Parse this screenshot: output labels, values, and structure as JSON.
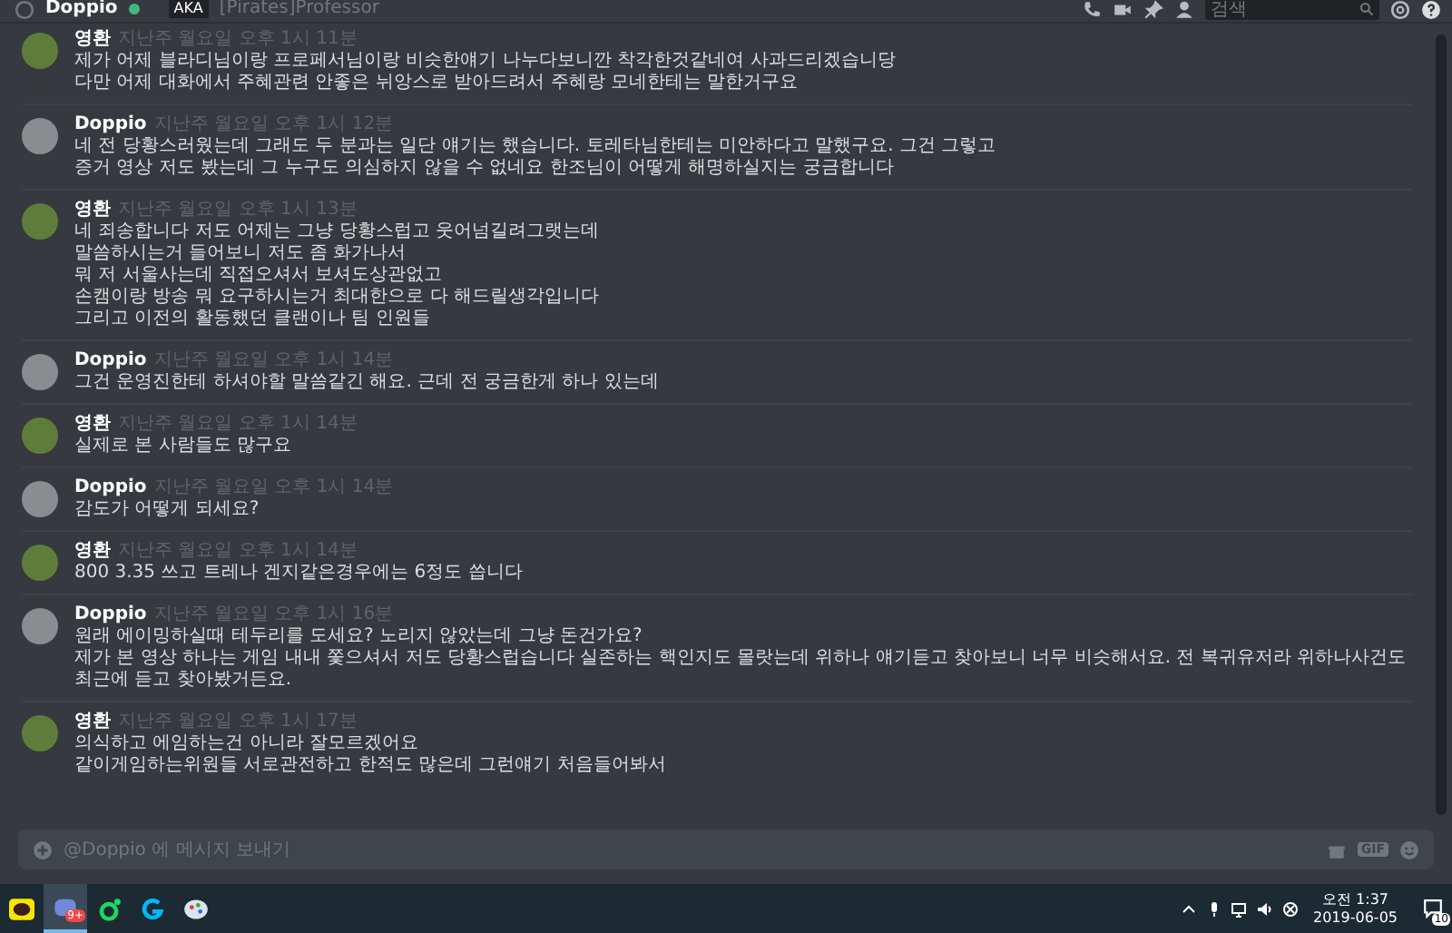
{
  "header": {
    "recipient": "Doppio",
    "online": true,
    "aka_badge": "AKA",
    "aka_name": "[Pirates]Professor",
    "search": {
      "placeholder": "검색"
    }
  },
  "messages": [
    {
      "author": "영환",
      "color": "#5f7d3a",
      "timestamp": "지난주 월요일 오후 1시 11분",
      "lines": [
        "제가 어제 블라디님이랑 프로페서님이랑 비슷한얘기 나누다보니깐 착각한것같네여 사과드리겠습니당",
        "다만 어제 대화에서 주혜관련 안좋은 뉘앙스로 받아드려서 주혜랑 모네한테는 말한거구요"
      ]
    },
    {
      "author": "Doppio",
      "color": "#8a8d90",
      "timestamp": "지난주 월요일 오후 1시 12분",
      "lines": [
        "네 전 당황스러웠는데 그래도 두 분과는 일단 얘기는 했습니다. 토레타님한테는 미안하다고 말했구요. 그건 그렇고",
        "증거 영상 저도 봤는데 그 누구도 의심하지 않을 수 없네요 한조님이 어떻게 해명하실지는 궁금합니다"
      ]
    },
    {
      "author": "영환",
      "color": "#5f7d3a",
      "timestamp": "지난주 월요일 오후 1시 13분",
      "lines": [
        "네 죄송합니다 저도 어제는 그냥 당황스럽고 웃어넘길려그랫는데",
        "말씀하시는거 들어보니 저도 좀 화가나서",
        "뭐 저 서울사는데 직접오셔서 보셔도상관없고",
        "손캠이랑 방송 뭐 요구하시는거 최대한으로 다 해드릴생각입니다",
        "그리고 이전의 활동했던 클랜이나 팀 인원들"
      ]
    },
    {
      "author": "Doppio",
      "color": "#8a8d90",
      "timestamp": "지난주 월요일 오후 1시 14분",
      "lines": [
        "그건 운영진한테 하셔야할 말씀같긴 해요. 근데 전 궁금한게 하나 있는데"
      ]
    },
    {
      "author": "영환",
      "color": "#5f7d3a",
      "timestamp": "지난주 월요일 오후 1시 14분",
      "lines": [
        "실제로 본 사람들도 많구요"
      ]
    },
    {
      "author": "Doppio",
      "color": "#8a8d90",
      "timestamp": "지난주 월요일 오후 1시 14분",
      "lines": [
        "감도가 어떻게 되세요?"
      ]
    },
    {
      "author": "영환",
      "color": "#5f7d3a",
      "timestamp": "지난주 월요일 오후 1시 14분",
      "lines": [
        "800 3.35 쓰고 트레나 겐지같은경우에는 6정도 씁니다"
      ]
    },
    {
      "author": "Doppio",
      "color": "#8a8d90",
      "timestamp": "지난주 월요일 오후 1시 16분",
      "lines": [
        "원래 에이밍하실때 테두리를 도세요? 노리지 않았는데 그냥 돈건가요?",
        "제가 본 영상 하나는 게임 내내 쫓으셔서 저도 당황스럽습니다 실존하는 핵인지도 몰랏는데 위하나 얘기듣고 찾아보니 너무 비슷해서요. 전 복귀유저라 위하나사건도 최근에 듣고 찾아봤거든요."
      ]
    },
    {
      "author": "영환",
      "color": "#5f7d3a",
      "timestamp": "지난주 월요일 오후 1시 17분",
      "lines": [
        "의식하고 에임하는건 아니라 잘모르겠어요",
        "같이게임하는위원들 서로관전하고 한적도 많은데 그런얘기 처음들어봐서"
      ]
    }
  ],
  "composer": {
    "placeholder": "@Doppio 에 메시지 보내기",
    "gif_label": "GIF"
  },
  "taskbar": {
    "apps": [
      {
        "kind": "chat",
        "selected": false
      },
      {
        "kind": "discord",
        "selected": true,
        "badge": "9+"
      },
      {
        "kind": "green",
        "selected": false
      },
      {
        "kind": "logi",
        "selected": false
      },
      {
        "kind": "paint",
        "selected": false
      }
    ],
    "time": "오전 1:37",
    "date": "2019-06-05",
    "notifications": "10"
  }
}
